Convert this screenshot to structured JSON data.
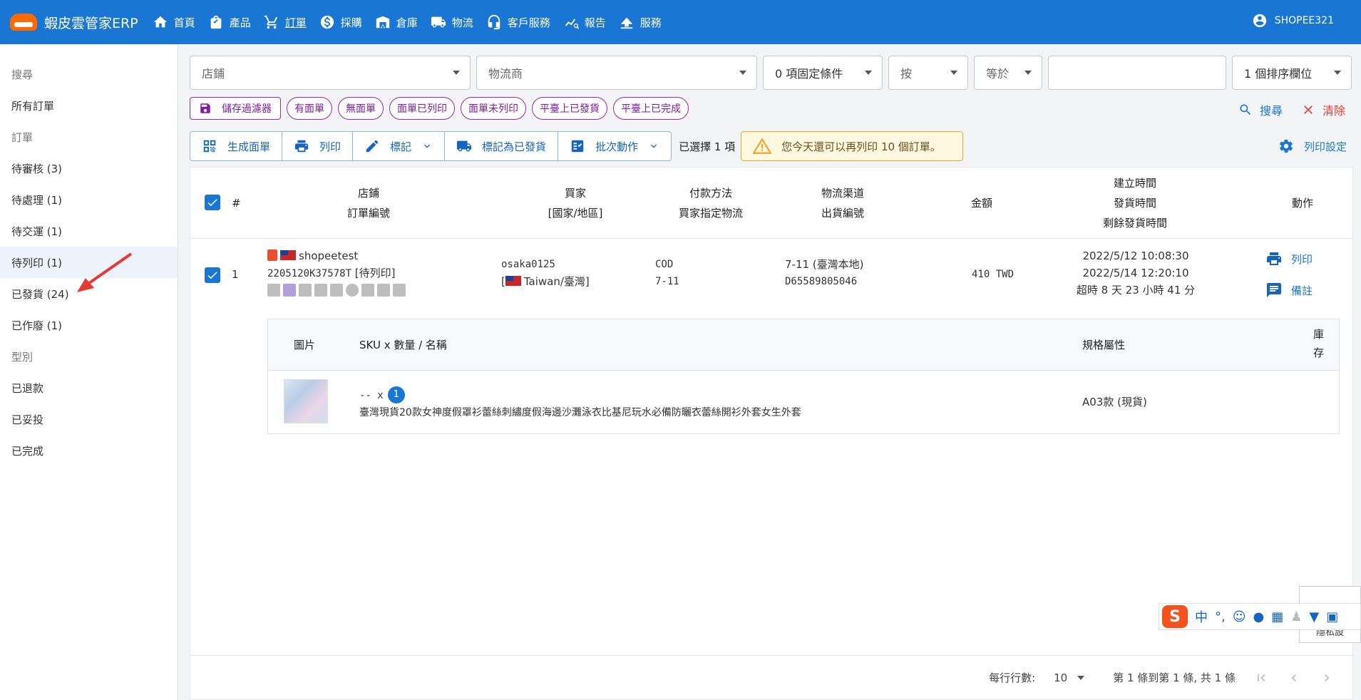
{
  "app": {
    "brand": "蝦皮雲管家ERP"
  },
  "nav": [
    {
      "label": "首頁",
      "icon": "home-icon"
    },
    {
      "label": "產品",
      "icon": "shopping-bag-icon"
    },
    {
      "label": "訂單",
      "icon": "cart-icon"
    },
    {
      "label": "採購",
      "icon": "dollar-icon"
    },
    {
      "label": "倉庫",
      "icon": "warehouse-icon"
    },
    {
      "label": "物流",
      "icon": "truck-icon"
    },
    {
      "label": "客戶服務",
      "icon": "headset-icon"
    },
    {
      "label": "報告",
      "icon": "chart-search-icon"
    },
    {
      "label": "服務",
      "icon": "cloud-upload-icon"
    }
  ],
  "user": {
    "name": "SHOPEE321"
  },
  "sidebar": {
    "items": [
      {
        "label": "搜尋",
        "type": "section"
      },
      {
        "label": "所有訂單",
        "type": "item"
      },
      {
        "label": "訂單",
        "type": "section"
      },
      {
        "label": "待審核 (3)",
        "type": "item"
      },
      {
        "label": "待處理 (1)",
        "type": "item"
      },
      {
        "label": "待交運 (1)",
        "type": "item"
      },
      {
        "label": "待列印 (1)",
        "type": "item",
        "active": true
      },
      {
        "label": "已發貨 (24)",
        "type": "item"
      },
      {
        "label": "已作廢 (1)",
        "type": "item"
      },
      {
        "label": "型別",
        "type": "section"
      },
      {
        "label": "已退款",
        "type": "item"
      },
      {
        "label": "已妥投",
        "type": "item"
      },
      {
        "label": "已完成",
        "type": "item"
      }
    ]
  },
  "filters": {
    "shop": "店鋪",
    "carrier": "物流商",
    "fixed_conditions": "0 項固定條件",
    "by": "按",
    "equals": "等於",
    "value": "",
    "sort": "1 個排序欄位"
  },
  "chips": {
    "save_filter": "儲存過濾器",
    "items": [
      "有面單",
      "無面單",
      "面單已列印",
      "面單未列印",
      "平臺上已發貨",
      "平臺上已完成"
    ]
  },
  "actions": {
    "search": "搜尋",
    "clear": "清除",
    "print_settings": "列印設定"
  },
  "toolbar": {
    "generate_label": "生成面單",
    "print": "列印",
    "mark": "標記",
    "mark_shipped": "標記為已發貨",
    "batch": "批次動作",
    "selected": "已選擇 1 項",
    "warning": "您今天還可以再列印 10 個訂單。"
  },
  "table": {
    "headers": {
      "index": "#",
      "shop": "店鋪",
      "order_no": "訂單編號",
      "buyer": "買家",
      "country": "[國家/地區]",
      "payment": "付款方法",
      "buyer_logistics": "買家指定物流",
      "channel": "物流渠道",
      "shipment_no": "出貨編號",
      "amount": "金額",
      "created": "建立時間",
      "shipped": "發貨時間",
      "remaining": "剩餘發貨時間",
      "action": "動作"
    },
    "rows": [
      {
        "index": "1",
        "shop": "shopeetest",
        "order_no": "2205120K37578T",
        "status": "[待列印]",
        "buyer": "osaka0125",
        "country": "Taiwan/臺灣",
        "payment": "COD",
        "buyer_logistics": "7-11",
        "channel": "7-11 (臺灣本地)",
        "shipment_no": "D65589805046",
        "amount": "410 TWD",
        "created": "2022/5/12 10:08:30",
        "shipped": "2022/5/14 12:20:10",
        "remaining": "超時 8 天 23 小時 41 分",
        "print": "列印",
        "note": "備註"
      }
    ],
    "items_head": {
      "image": "圖片",
      "sku": "SKU x 數量 / 名稱",
      "spec": "規格屬性",
      "stock": "庫存"
    },
    "items": [
      {
        "sku": "-- x",
        "qty": "1",
        "name": "臺灣現貨20款女神度假罩衫蕾絲刺繡度假海邊沙灘泳衣比基尼玩水必備防曬衣蕾絲開衫外套女生外套",
        "spec": "A03款 (現貨)"
      }
    ]
  },
  "pager": {
    "rows_per_page_label": "每行行數:",
    "rows_per_page": "10",
    "range": "第 1 條到第 1 條, 共 1 條"
  },
  "ime": {
    "lang": "中",
    "privacy": "隱私設"
  }
}
